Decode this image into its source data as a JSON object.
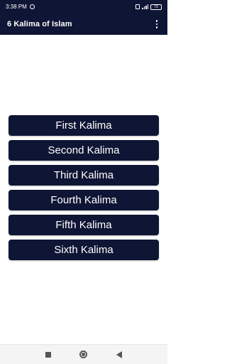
{
  "status_bar": {
    "time": "3:38 PM",
    "battery": "73",
    "icons": [
      "alarm-icon",
      "sim-icon",
      "signal-icon",
      "battery-icon"
    ]
  },
  "app_bar": {
    "title": "6 Kalima of Islam",
    "menu_icon": "overflow-menu-icon"
  },
  "buttons": [
    {
      "label": "First Kalima"
    },
    {
      "label": "Second Kalima"
    },
    {
      "label": "Third Kalima"
    },
    {
      "label": "Fourth Kalima"
    },
    {
      "label": "Fifth Kalima"
    },
    {
      "label": "Sixth Kalima"
    }
  ],
  "nav_bar": {
    "icons": [
      "recents-square-icon",
      "home-circle-icon",
      "back-triangle-icon"
    ]
  },
  "colors": {
    "primary": "#0f1534",
    "background": "#ffffff",
    "text_on_primary": "#ffffff"
  }
}
